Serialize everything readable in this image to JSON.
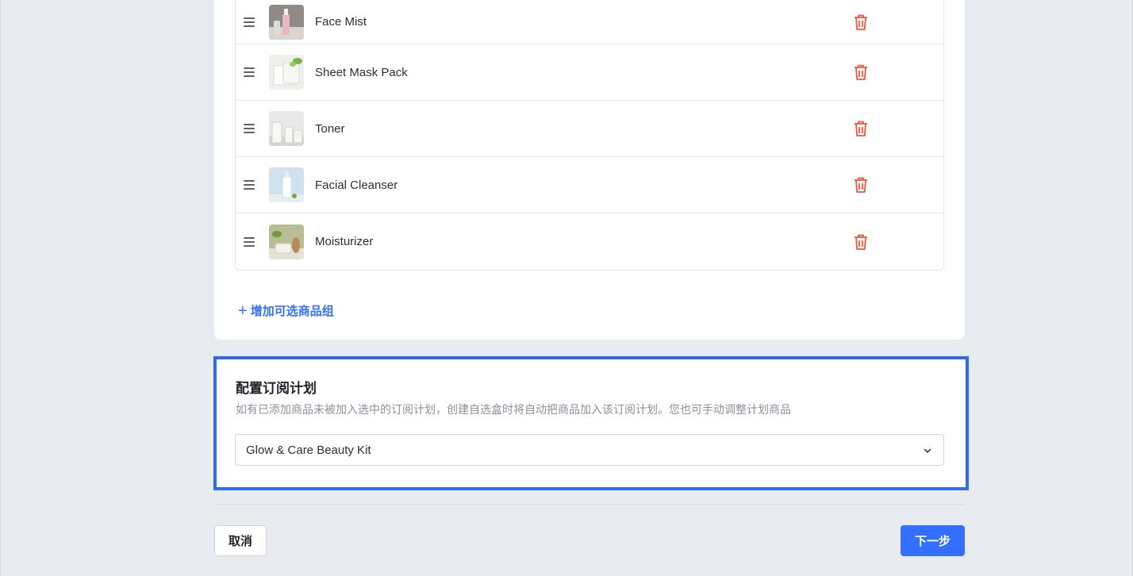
{
  "products": [
    {
      "name": "Face Mist",
      "thumb_icon": "face-mist-bottle"
    },
    {
      "name": "Sheet Mask Pack",
      "thumb_icon": "sheet-mask-box"
    },
    {
      "name": "Toner",
      "thumb_icon": "toner-bottle"
    },
    {
      "name": "Facial Cleanser",
      "thumb_icon": "cleanser-bottle"
    },
    {
      "name": "Moisturizer",
      "thumb_icon": "moisturizer-jar"
    }
  ],
  "add_group": {
    "icon": "+",
    "label": "增加可选商品组"
  },
  "plan": {
    "title": "配置订阅计划",
    "description": "如有已添加商品未被加入选中的订阅计划，创建自选盒时将自动把商品加入该订阅计划。您也可手动调整计划商品",
    "selected": "Glow & Care Beauty Kit"
  },
  "footer": {
    "cancel_label": "取消",
    "next_label": "下一步"
  },
  "colors": {
    "accent": "#3370ff",
    "delete": "#f0553c",
    "highlight_border": "#2f6bf0",
    "background": "#e8ebf0"
  }
}
